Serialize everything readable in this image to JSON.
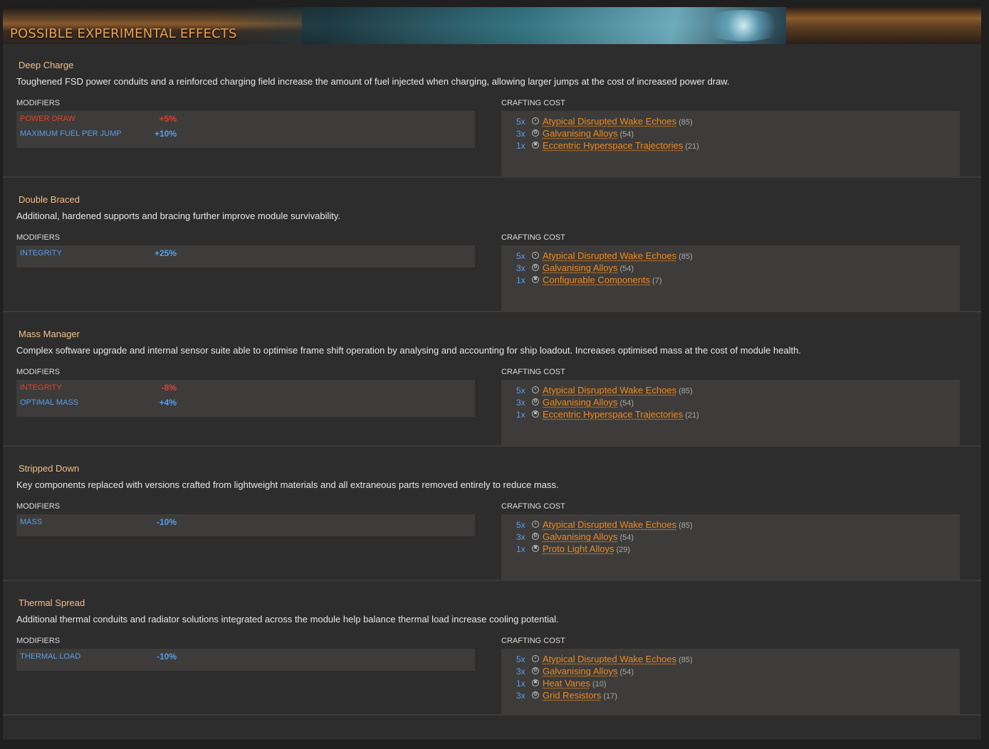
{
  "header": {
    "title": "POSSIBLE EXPERIMENTAL EFFECTS"
  },
  "labels": {
    "modifiers": "MODIFIERS",
    "crafting_cost": "CRAFTING COST"
  },
  "colors": {
    "negative": "#e0412a",
    "positive": "#5a9ee6",
    "material": "#f08a1e",
    "title": "#f1a34a"
  },
  "effects": [
    {
      "name": "Deep Charge",
      "description": "Toughened FSD power conduits and a reinforced charging field increase the amount of fuel injected when charging, allowing larger jumps at the cost of increased power draw.",
      "modifiers": [
        {
          "label": "POWER DRAW",
          "value": "+5%",
          "kind": "neg"
        },
        {
          "label": "MAXIMUM FUEL PER JUMP",
          "value": "+10%",
          "kind": "pos"
        }
      ],
      "costs": [
        {
          "qty": "5x",
          "icon": "atom-icon",
          "name": "Atypical Disrupted Wake Echoes",
          "count": "(85)"
        },
        {
          "qty": "3x",
          "icon": "gear-icon",
          "name": "Galvanising Alloys",
          "count": "(54)"
        },
        {
          "qty": "1x",
          "icon": "cross-icon",
          "name": "Eccentric Hyperspace Trajectories",
          "count": "(21)"
        }
      ]
    },
    {
      "name": "Double Braced",
      "description": "Additional, hardened supports and bracing further improve module survivability.",
      "modifiers": [
        {
          "label": "INTEGRITY",
          "value": "+25%",
          "kind": "pos"
        }
      ],
      "costs": [
        {
          "qty": "5x",
          "icon": "atom-icon",
          "name": "Atypical Disrupted Wake Echoes",
          "count": "(85)"
        },
        {
          "qty": "3x",
          "icon": "gear-icon",
          "name": "Galvanising Alloys",
          "count": "(54)"
        },
        {
          "qty": "1x",
          "icon": "cross-icon",
          "name": "Configurable Components",
          "count": "(7)"
        }
      ]
    },
    {
      "name": "Mass Manager",
      "description": "Complex software upgrade and internal sensor suite able to optimise frame shift operation by analysing and accounting for ship loadout. Increases optimised mass at the cost of module health.",
      "modifiers": [
        {
          "label": "INTEGRITY",
          "value": "-8%",
          "kind": "neg"
        },
        {
          "label": "OPTIMAL MASS",
          "value": "+4%",
          "kind": "pos"
        }
      ],
      "costs": [
        {
          "qty": "5x",
          "icon": "atom-icon",
          "name": "Atypical Disrupted Wake Echoes",
          "count": "(85)"
        },
        {
          "qty": "3x",
          "icon": "gear-icon",
          "name": "Galvanising Alloys",
          "count": "(54)"
        },
        {
          "qty": "1x",
          "icon": "cross-icon",
          "name": "Eccentric Hyperspace Trajectories",
          "count": "(21)"
        }
      ]
    },
    {
      "name": "Stripped Down",
      "description": "Key components replaced with versions crafted from lightweight materials and all extraneous parts removed entirely to reduce mass.",
      "modifiers": [
        {
          "label": "MASS",
          "value": "-10%",
          "kind": "pos"
        }
      ],
      "costs": [
        {
          "qty": "5x",
          "icon": "atom-icon",
          "name": "Atypical Disrupted Wake Echoes",
          "count": "(85)"
        },
        {
          "qty": "3x",
          "icon": "gear-icon",
          "name": "Galvanising Alloys",
          "count": "(54)"
        },
        {
          "qty": "1x",
          "icon": "cross-icon",
          "name": "Proto Light Alloys",
          "count": "(29)"
        }
      ]
    },
    {
      "name": "Thermal Spread",
      "description": "Additional thermal conduits and radiator solutions integrated across the module help balance thermal load increase cooling potential.",
      "modifiers": [
        {
          "label": "THERMAL LOAD",
          "value": "-10%",
          "kind": "pos"
        }
      ],
      "costs": [
        {
          "qty": "5x",
          "icon": "atom-icon",
          "name": "Atypical Disrupted Wake Echoes",
          "count": "(85)"
        },
        {
          "qty": "3x",
          "icon": "gear-icon",
          "name": "Galvanising Alloys",
          "count": "(54)"
        },
        {
          "qty": "1x",
          "icon": "cross-icon",
          "name": "Heat Vanes",
          "count": "(10)"
        },
        {
          "qty": "3x",
          "icon": "gear-icon",
          "name": "Grid Resistors",
          "count": "(17)"
        }
      ]
    }
  ]
}
